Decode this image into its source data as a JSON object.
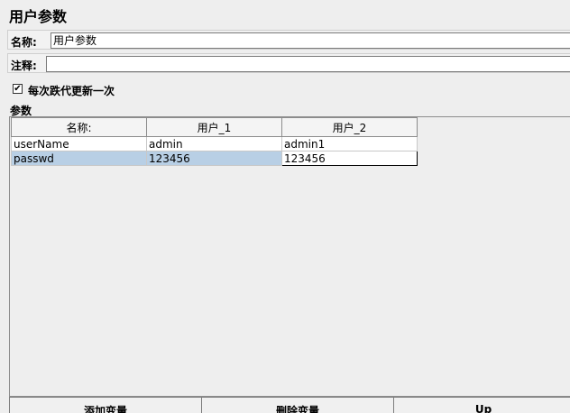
{
  "page": {
    "title": "用户参数"
  },
  "form": {
    "name_label": "名称:",
    "name_value": "用户参数",
    "comment_label": "注释:",
    "comment_value": ""
  },
  "options": {
    "update_each_iteration_label": "每次跌代更新一次",
    "update_each_iteration_checked": true,
    "check_glyph": "✔"
  },
  "parameters": {
    "section_label": "参数",
    "columns": [
      "名称:",
      "用户_1",
      "用户_2"
    ],
    "rows": [
      [
        "userName",
        "admin",
        "admin1"
      ],
      [
        "passwd",
        "123456",
        "123456"
      ]
    ],
    "selected_row": 1,
    "editing_cell": 2
  },
  "buttons": {
    "add": "添加变量",
    "delete": "删除变量",
    "up": "Up"
  }
}
